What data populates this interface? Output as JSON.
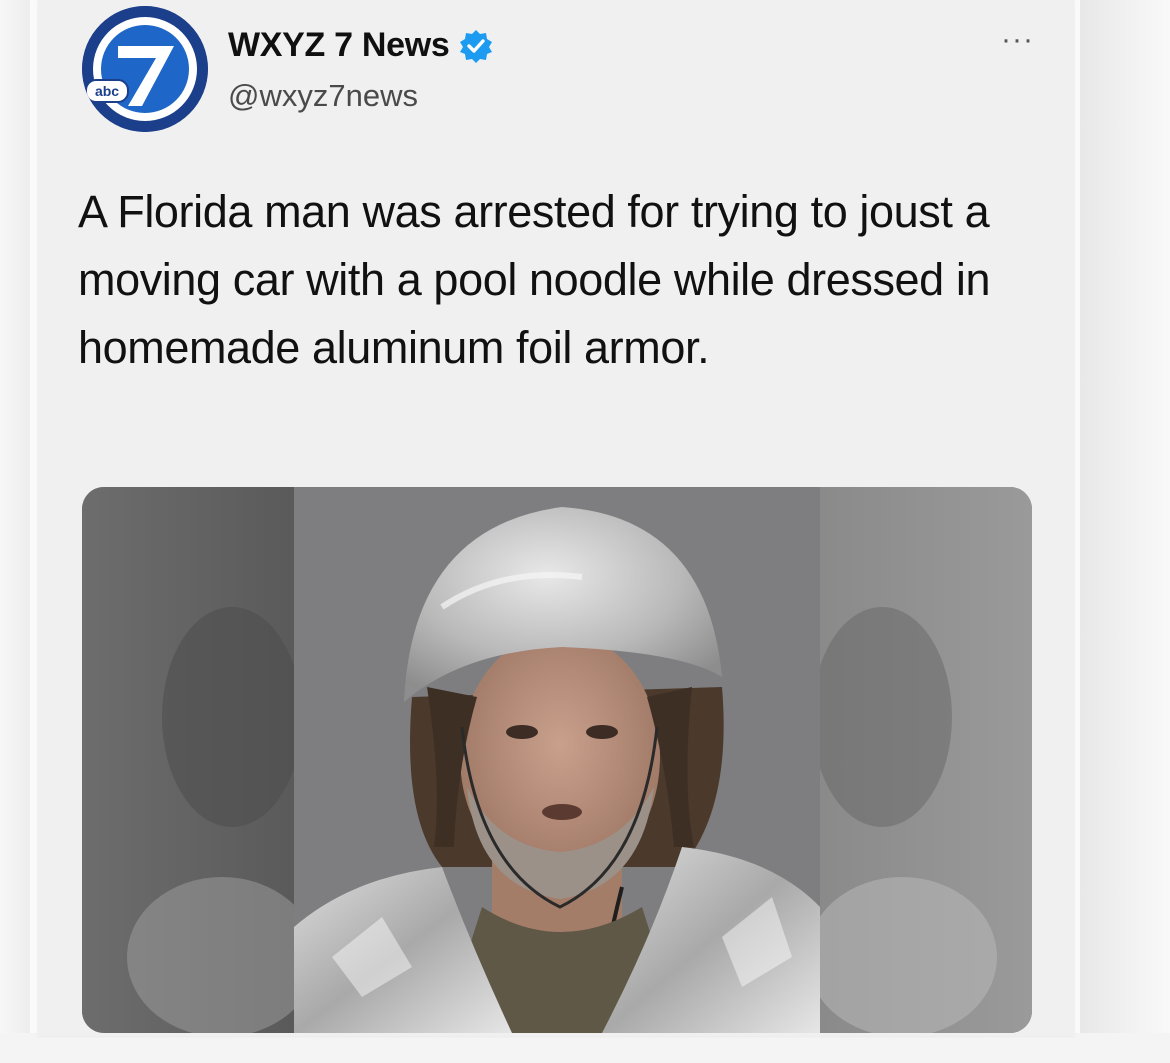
{
  "tweet": {
    "author_name": "WXYZ 7 News",
    "author_handle": "@wxyz7news",
    "verified": true,
    "avatar_label": "abc",
    "more_label": "···",
    "text": "A Florida man was arrested for trying to joust a moving car with a pool noodle while dressed in homemade aluminum foil armor."
  },
  "colors": {
    "brand_blue": "#1b3f8b",
    "verified_blue": "#1d9bf0"
  },
  "icons": {
    "avatar": "wxyz-7-logo",
    "verified": "verified-badge-icon",
    "more": "more-options-icon"
  }
}
